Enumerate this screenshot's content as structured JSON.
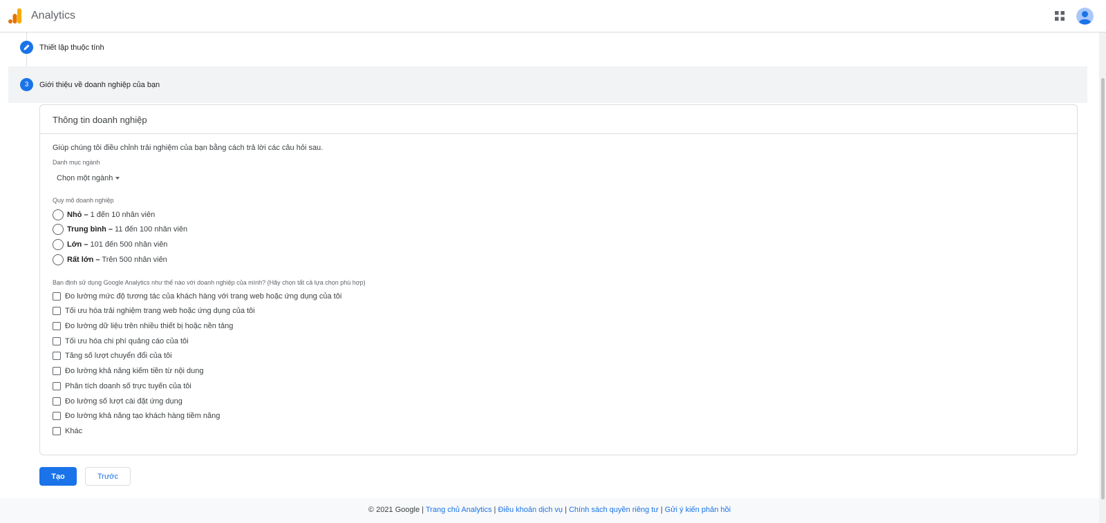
{
  "header": {
    "app_title": "Analytics"
  },
  "steps": {
    "step2_label": "Thiết lập thuộc tính",
    "step3_number": "3",
    "step3_label": "Giới thiệu về doanh nghiệp của bạn"
  },
  "card": {
    "title": "Thông tin doanh nghiệp",
    "intro": "Giúp chúng tôi điều chỉnh trải nghiệm của bạn bằng cách trả lời các câu hỏi sau.",
    "industry_label": "Danh mục ngành",
    "industry_select": "Chọn một ngành",
    "size_label": "Quy mô doanh nghiệp",
    "sizes": [
      {
        "name": "Nhỏ –",
        "range": " 1 đến 10 nhân viên"
      },
      {
        "name": "Trung bình –",
        "range": " 11 đến 100 nhân viên"
      },
      {
        "name": "Lớn –",
        "range": " 101 đến 500 nhân viên"
      },
      {
        "name": "Rất lớn –",
        "range": " Trên 500 nhân viên"
      }
    ],
    "usage_label": "Bạn định sử dụng Google Analytics như thế nào với doanh nghiệp của mình? (Hãy chọn tất cả lựa chọn phù hợp)",
    "usage_options": [
      "Đo lường mức độ tương tác của khách hàng với trang web hoặc ứng dụng của tôi",
      "Tối ưu hóa trải nghiệm trang web hoặc ứng dụng của tôi",
      "Đo lường dữ liệu trên nhiều thiết bị hoặc nền tảng",
      "Tối ưu hóa chi phí quảng cáo của tôi",
      "Tăng số lượt chuyển đổi của tôi",
      "Đo lường khả năng kiếm tiền từ nội dung",
      "Phân tích doanh số trực tuyến của tôi",
      "Đo lường số lượt cài đặt ứng dụng",
      "Đo lường khả năng tạo khách hàng tiềm năng",
      "Khác"
    ]
  },
  "actions": {
    "create": "Tạo",
    "back": "Trước"
  },
  "footer": {
    "copyright": "© 2021 Google | ",
    "link_home": "Trang chủ Analytics",
    "sep1": " | ",
    "link_terms": "Điều khoản dịch vụ",
    "sep2": " | ",
    "link_privacy": "Chính sách quyền riêng tư",
    "sep3": " | ",
    "link_feedback": "Gửi ý kiến phản hồi"
  },
  "colors": {
    "accent": "#1a73e8",
    "logo_orange": "#f9ab00",
    "logo_dark_orange": "#e37400"
  }
}
